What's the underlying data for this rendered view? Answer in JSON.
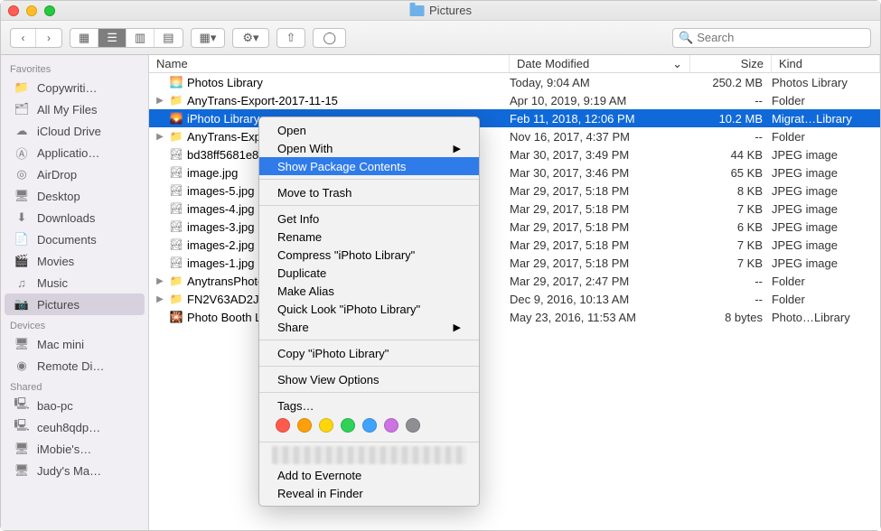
{
  "window": {
    "title": "Pictures"
  },
  "toolbar": {
    "search_placeholder": "Search"
  },
  "columns": {
    "name": "Name",
    "date": "Date Modified",
    "size": "Size",
    "kind": "Kind"
  },
  "sidebar": {
    "sections": [
      {
        "heading": "Favorites",
        "items": [
          {
            "icon": "folder",
            "label": "Copywriti…"
          },
          {
            "icon": "all",
            "label": "All My Files"
          },
          {
            "icon": "cloud",
            "label": "iCloud Drive"
          },
          {
            "icon": "apps",
            "label": "Applicatio…"
          },
          {
            "icon": "airdrop",
            "label": "AirDrop"
          },
          {
            "icon": "desktop",
            "label": "Desktop"
          },
          {
            "icon": "downloads",
            "label": "Downloads"
          },
          {
            "icon": "docs",
            "label": "Documents"
          },
          {
            "icon": "movies",
            "label": "Movies"
          },
          {
            "icon": "music",
            "label": "Music"
          },
          {
            "icon": "pictures",
            "label": "Pictures",
            "selected": true
          }
        ]
      },
      {
        "heading": "Devices",
        "items": [
          {
            "icon": "mac",
            "label": "Mac mini"
          },
          {
            "icon": "disc",
            "label": "Remote Di…"
          }
        ]
      },
      {
        "heading": "Shared",
        "items": [
          {
            "icon": "pc",
            "label": "bao-pc"
          },
          {
            "icon": "pc",
            "label": "ceuh8qdp…"
          },
          {
            "icon": "mac",
            "label": "iMobie's…"
          },
          {
            "icon": "mac",
            "label": "Judy's Ma…"
          }
        ]
      }
    ]
  },
  "files": [
    {
      "expand": false,
      "folder": false,
      "icon": "photos",
      "name": "Photos Library",
      "date": "Today, 9:04 AM",
      "size": "250.2 MB",
      "kind": "Photos Library"
    },
    {
      "expand": true,
      "folder": true,
      "icon": "folder",
      "name": "AnyTrans-Export-2017-11-15",
      "date": "Apr 10, 2019, 9:19 AM",
      "size": "--",
      "kind": "Folder"
    },
    {
      "expand": false,
      "folder": false,
      "icon": "iphoto",
      "name": "iPhoto Library",
      "date": "Feb 11, 2018, 12:06 PM",
      "size": "10.2 MB",
      "kind": "Migrat…Library",
      "selected": true
    },
    {
      "expand": true,
      "folder": true,
      "icon": "folder",
      "name": "AnyTrans-Export",
      "date": "Nov 16, 2017, 4:37 PM",
      "size": "--",
      "kind": "Folder"
    },
    {
      "expand": false,
      "folder": false,
      "icon": "image",
      "name": "bd38ff5681e87",
      "date": "Mar 30, 2017, 3:49 PM",
      "size": "44 KB",
      "kind": "JPEG image"
    },
    {
      "expand": false,
      "folder": false,
      "icon": "image",
      "name": "image.jpg",
      "date": "Mar 30, 2017, 3:46 PM",
      "size": "65 KB",
      "kind": "JPEG image"
    },
    {
      "expand": false,
      "folder": false,
      "icon": "image",
      "name": "images-5.jpg",
      "date": "Mar 29, 2017, 5:18 PM",
      "size": "8 KB",
      "kind": "JPEG image"
    },
    {
      "expand": false,
      "folder": false,
      "icon": "image",
      "name": "images-4.jpg",
      "date": "Mar 29, 2017, 5:18 PM",
      "size": "7 KB",
      "kind": "JPEG image"
    },
    {
      "expand": false,
      "folder": false,
      "icon": "image",
      "name": "images-3.jpg",
      "date": "Mar 29, 2017, 5:18 PM",
      "size": "6 KB",
      "kind": "JPEG image"
    },
    {
      "expand": false,
      "folder": false,
      "icon": "image",
      "name": "images-2.jpg",
      "date": "Mar 29, 2017, 5:18 PM",
      "size": "7 KB",
      "kind": "JPEG image"
    },
    {
      "expand": false,
      "folder": false,
      "icon": "image",
      "name": "images-1.jpg",
      "date": "Mar 29, 2017, 5:18 PM",
      "size": "7 KB",
      "kind": "JPEG image"
    },
    {
      "expand": true,
      "folder": true,
      "icon": "folder",
      "name": "AnytransPhotoB",
      "date": "Mar 29, 2017, 2:47 PM",
      "size": "--",
      "kind": "Folder"
    },
    {
      "expand": true,
      "folder": true,
      "icon": "folder",
      "name": "FN2V63AD2J.co",
      "date": "Dec 9, 2016, 10:13 AM",
      "size": "--",
      "kind": "Folder"
    },
    {
      "expand": false,
      "folder": false,
      "icon": "photobooth",
      "name": "Photo Booth Lib",
      "date": "May 23, 2016, 11:53 AM",
      "size": "8 bytes",
      "kind": "Photo…Library"
    }
  ],
  "context_menu": {
    "items": [
      {
        "label": "Open"
      },
      {
        "label": "Open With",
        "submenu": true
      },
      {
        "label": "Show Package Contents",
        "highlighted": true
      },
      {
        "sep": true
      },
      {
        "label": "Move to Trash"
      },
      {
        "sep": true
      },
      {
        "label": "Get Info"
      },
      {
        "label": "Rename"
      },
      {
        "label": "Compress \"iPhoto Library\""
      },
      {
        "label": "Duplicate"
      },
      {
        "label": "Make Alias"
      },
      {
        "label": "Quick Look \"iPhoto Library\""
      },
      {
        "label": "Share",
        "submenu": true
      },
      {
        "sep": true
      },
      {
        "label": "Copy \"iPhoto Library\""
      },
      {
        "sep": true
      },
      {
        "label": "Show View Options"
      },
      {
        "sep": true
      },
      {
        "label": "Tags…"
      },
      {
        "tags": true
      },
      {
        "sep": true
      },
      {
        "blur": true
      },
      {
        "label": "Add to Evernote"
      },
      {
        "label": "Reveal in Finder"
      }
    ],
    "tag_colors": [
      "#ff5b4c",
      "#ff9f0a",
      "#ffd60c",
      "#30d159",
      "#40a3ff",
      "#cc73e1",
      "#8e8e93"
    ]
  }
}
